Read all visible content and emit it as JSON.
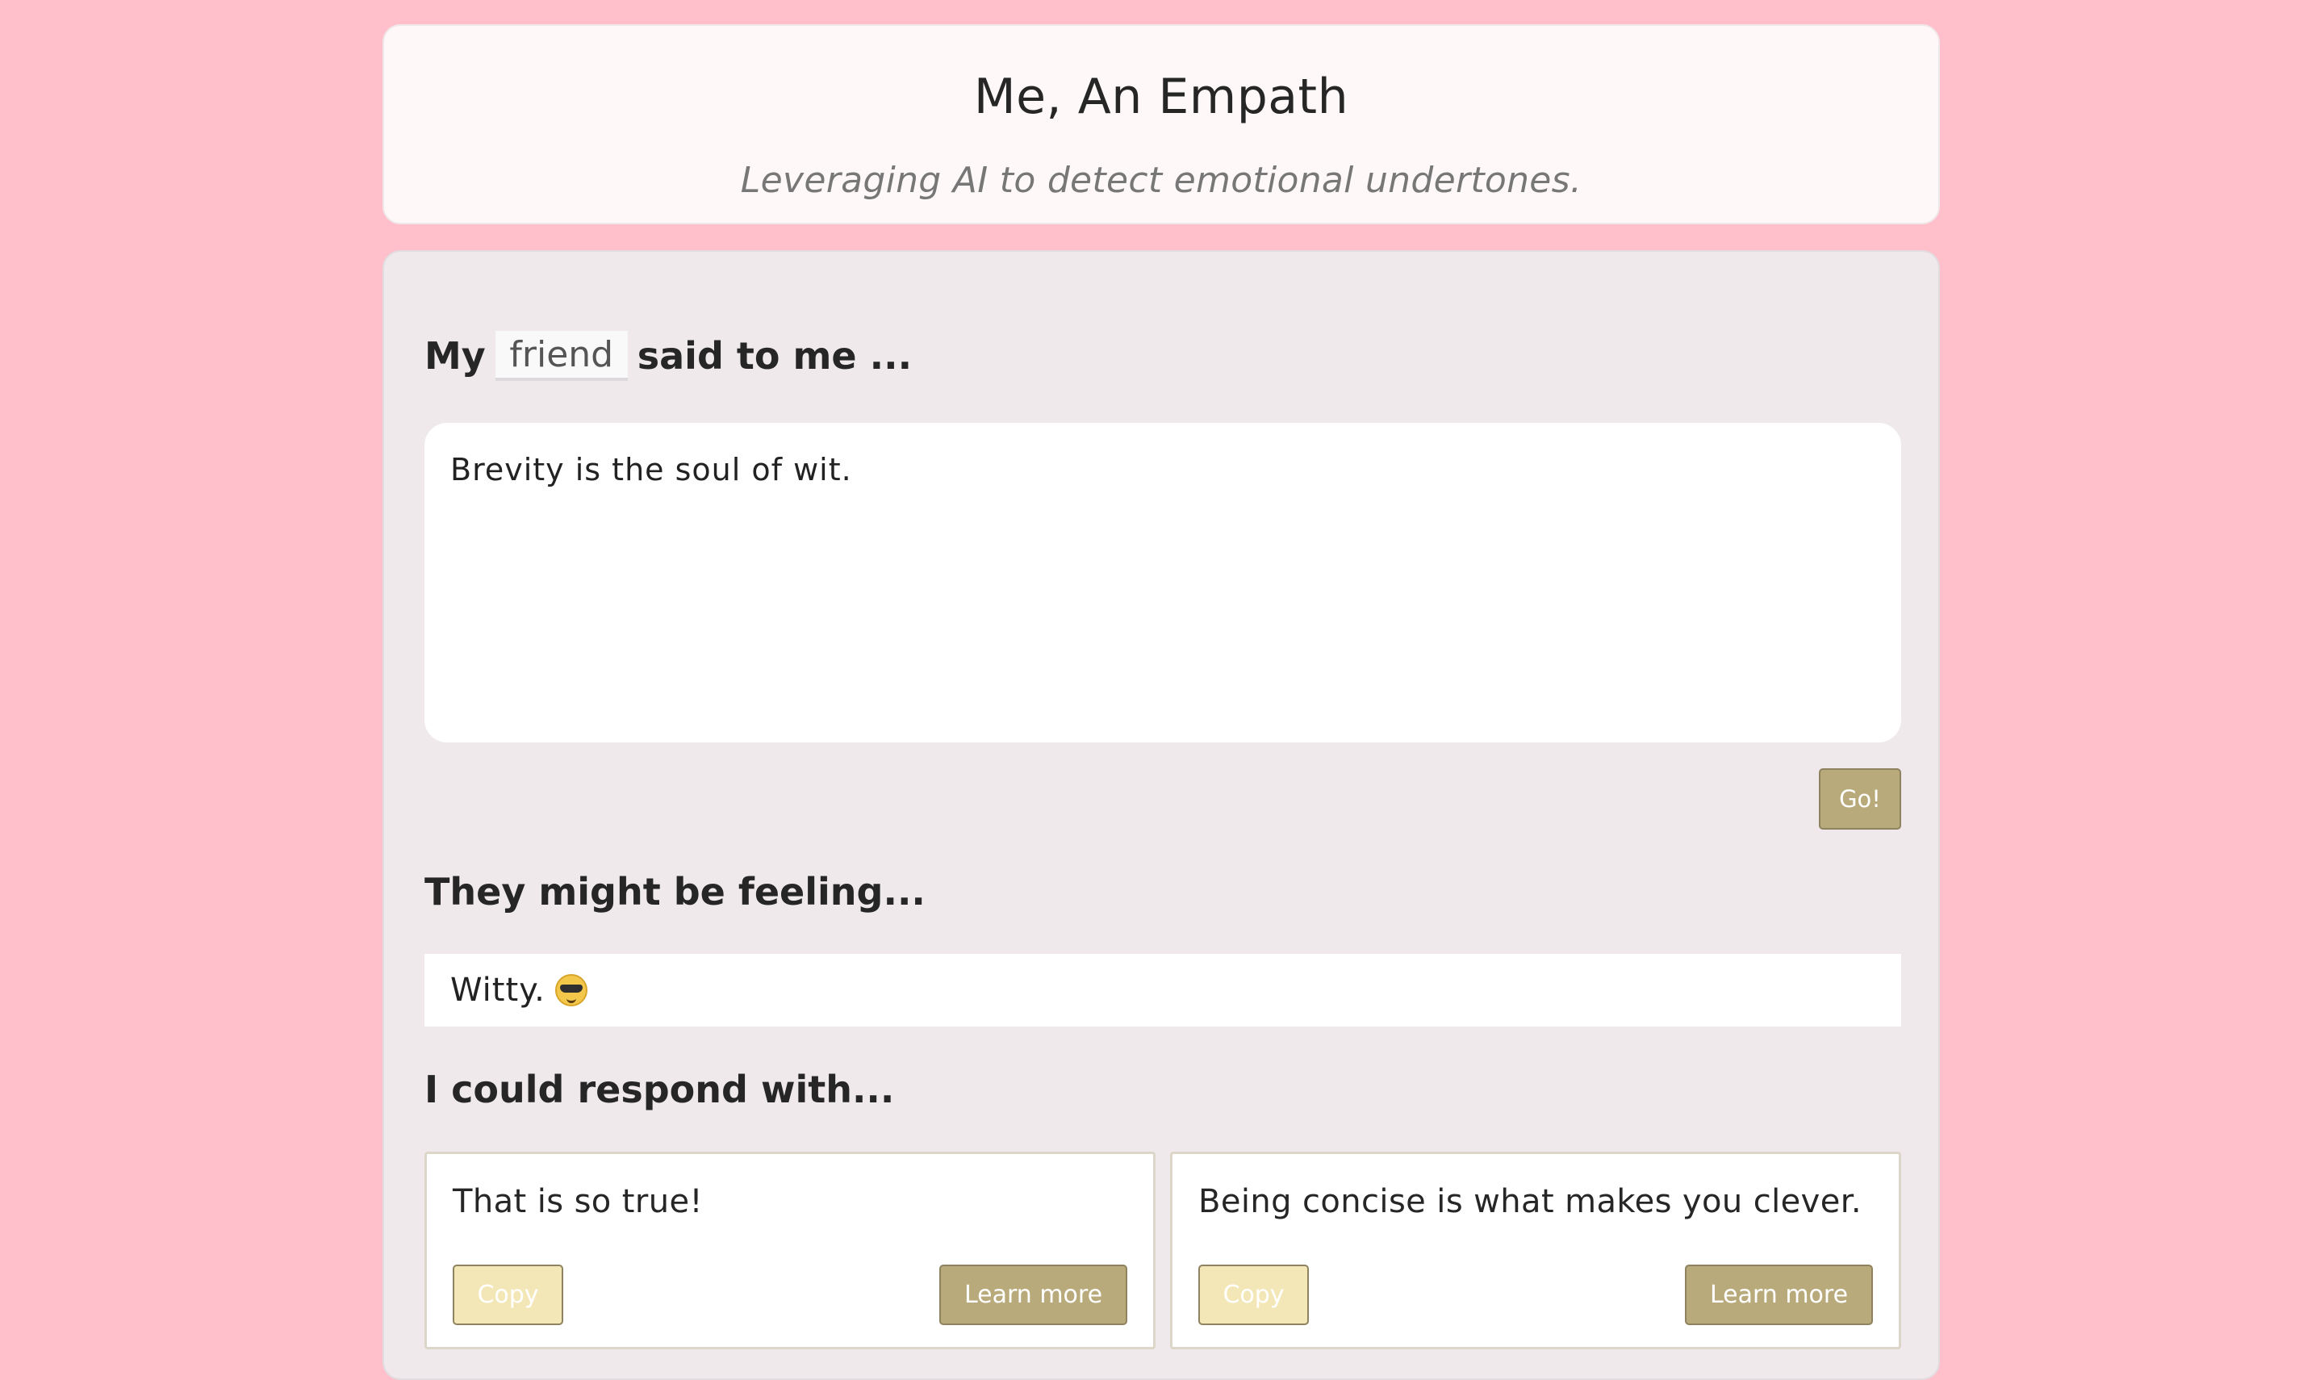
{
  "app": {
    "title": "Me, An Empath",
    "subtitle": "Leveraging AI to detect emotional undertones."
  },
  "prompt": {
    "prefix": "My",
    "relation_value": "friend",
    "suffix": "said to me ..."
  },
  "message": {
    "value": "Brevity is the soul of wit."
  },
  "actions": {
    "go_label": "Go!"
  },
  "feelings": {
    "heading": "They might be feeling...",
    "value": "Witty.",
    "emoji_icon": "sunglasses-emoji-icon"
  },
  "responses": {
    "heading": "I could respond with...",
    "items": [
      {
        "text": "That is so true!",
        "copy_label": "Copy",
        "learn_more_label": "Learn more"
      },
      {
        "text": "Being concise is what makes you clever.",
        "copy_label": "Copy",
        "learn_more_label": "Learn more"
      }
    ]
  },
  "colors": {
    "page_background": "#ffbfcb",
    "header_background": "#fff8f8",
    "panel_background": "#efe9eb",
    "primary_button": "#b9aa7c",
    "copy_button": "#f4e7b7"
  }
}
